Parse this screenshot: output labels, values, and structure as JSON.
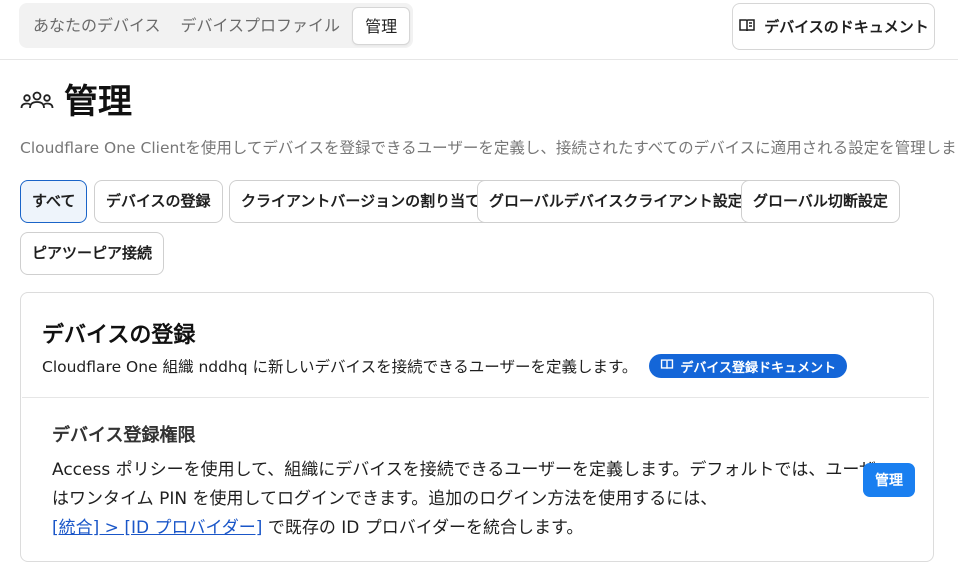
{
  "tabs": [
    {
      "label": "あなたのデバイス",
      "active": false
    },
    {
      "label": "デバイスプロファイル",
      "active": false
    },
    {
      "label": "管理",
      "active": true
    }
  ],
  "header": {
    "doc_button_label": "デバイスのドキュメント",
    "doc_icon": "book-icon"
  },
  "page": {
    "title": "管理",
    "title_icon": "users-icon",
    "description": "Cloudflare One Clientを使用してデバイスを登録できるユーザーを定義し、接続されたすべてのデバイスに適用される設定を管理します。"
  },
  "filters": [
    {
      "label": "すべて",
      "active": true
    },
    {
      "label": "デバイスの登録",
      "active": false
    },
    {
      "label": "クライアントバージョンの割り当て",
      "active": false
    },
    {
      "label": "グローバルデバイスクライアント設定",
      "active": false
    },
    {
      "label": "グローバル切断設定",
      "active": false
    },
    {
      "label": "ピアツーピア接続",
      "active": false
    }
  ],
  "enrollment_card": {
    "title": "デバイスの登録",
    "description": "Cloudflare One 組織 nddhq に新しいデバイスを接続できるユーザーを定義します。",
    "doc_badge_label": "デバイス登録ドキュメント",
    "permissions": {
      "title": "デバイス登録権限",
      "line1": "Access ポリシーを使用して、組織にデバイスを接続できるユーザーを定義します。デフォルトでは、ユーザー",
      "line2": "はワンタイム PIN を使用してログインできます。追加のログイン方法を使用するには、",
      "link_text": "[統合] > [ID プロバイダー]",
      "line3_suffix": " で既存の ID プロバイダーを統合します。",
      "manage_button_label": "管理"
    }
  },
  "colors": {
    "accent": "#1a7ff0",
    "badge": "#1466d8",
    "link": "#1a56c8",
    "active_chip_border": "#1a64c8"
  }
}
